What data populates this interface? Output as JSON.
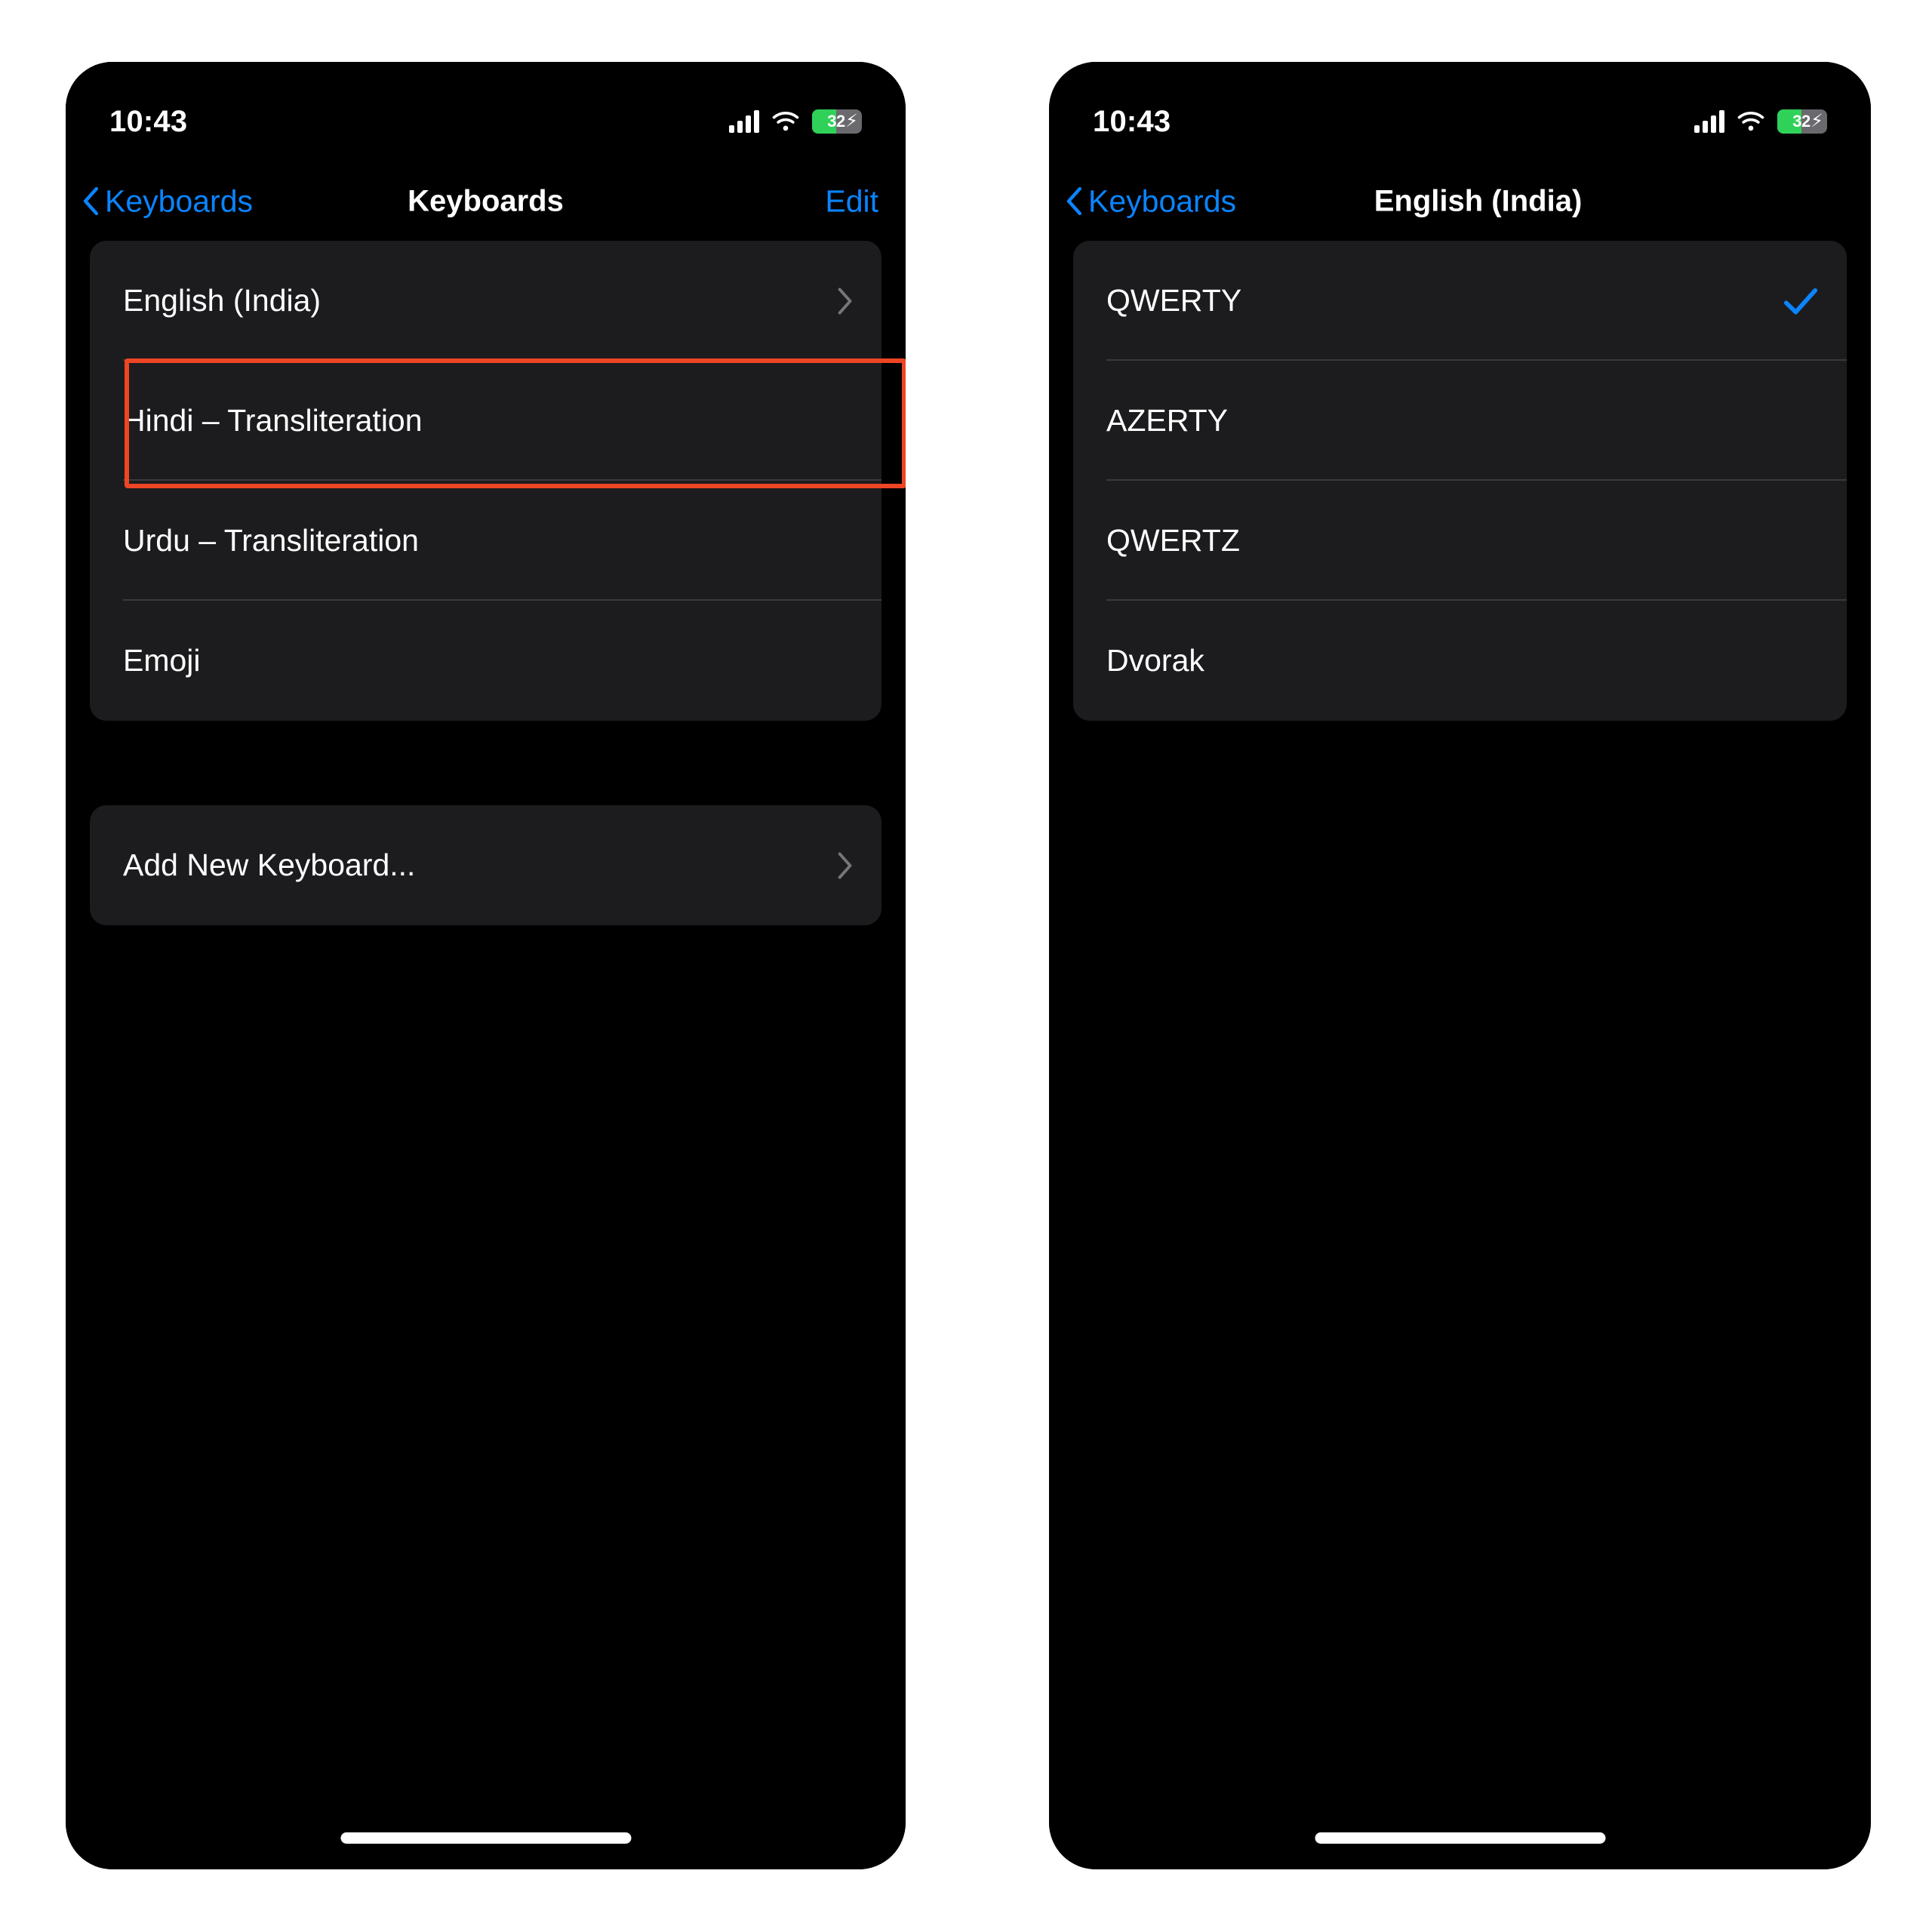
{
  "status_bar": {
    "time": "10:43",
    "cellular_icon": "cellular-signal-icon",
    "wifi_icon": "wifi-icon",
    "battery": {
      "level_label": "32",
      "charging_glyph": "⚡",
      "fill_color": "#30d158",
      "charging": true
    }
  },
  "colors": {
    "accent_blue": "#0a84ff",
    "highlight_red": "#ee4524",
    "card_bg": "#1c1c1e",
    "screen_bg": "#000000",
    "separator": "#3a3a3c",
    "chevron_grey": "#7a7a80"
  },
  "screens": [
    {
      "id": "keyboards-list",
      "nav": {
        "back_label": "Keyboards",
        "title": "Keyboards",
        "action_label": "Edit"
      },
      "sections": [
        {
          "id": "installed-keyboards",
          "rows": [
            {
              "label": "English (India)",
              "accessory": "chevron",
              "highlighted": true
            },
            {
              "label": "Hindi – Transliteration",
              "accessory": "none",
              "highlighted": false
            },
            {
              "label": "Urdu – Transliteration",
              "accessory": "none",
              "highlighted": false
            },
            {
              "label": "Emoji",
              "accessory": "none",
              "highlighted": false
            }
          ]
        },
        {
          "id": "add-keyboard",
          "rows": [
            {
              "label": "Add New Keyboard...",
              "accessory": "chevron",
              "highlighted": false
            }
          ]
        }
      ]
    },
    {
      "id": "english-india-layouts",
      "nav": {
        "back_label": "Keyboards",
        "title": "English (India)",
        "action_label": ""
      },
      "sections": [
        {
          "id": "layout-options",
          "rows": [
            {
              "label": "QWERTY",
              "accessory": "check",
              "highlighted": false
            },
            {
              "label": "AZERTY",
              "accessory": "none",
              "highlighted": false
            },
            {
              "label": "QWERTZ",
              "accessory": "none",
              "highlighted": false
            },
            {
              "label": "Dvorak",
              "accessory": "none",
              "highlighted": false
            }
          ]
        }
      ]
    }
  ]
}
